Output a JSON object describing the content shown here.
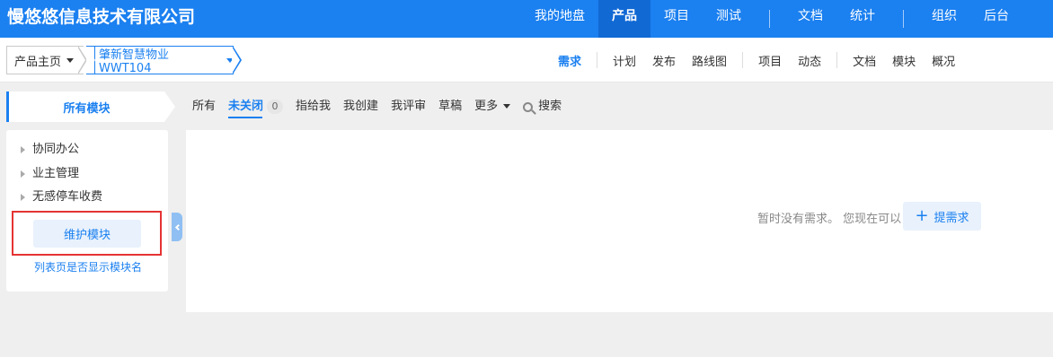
{
  "header": {
    "brand": "慢悠悠信息技术有限公司",
    "nav": [
      "我的地盘",
      "产品",
      "项目",
      "测试",
      "文档",
      "统计",
      "组织",
      "后台"
    ],
    "active_nav": "产品"
  },
  "breadcrumb": {
    "home": "产品主页",
    "product": "肇新智慧物业WWT104"
  },
  "subnav": [
    "需求",
    "计划",
    "发布",
    "路线图",
    "项目",
    "动态",
    "文档",
    "模块",
    "概况"
  ],
  "subnav_active": "需求",
  "module_panel": {
    "title": "所有模块",
    "tree": [
      "协同办公",
      "业主管理",
      "无感停车收费"
    ],
    "maintain_button": "维护模块",
    "show_module_name_link": "列表页是否显示模块名"
  },
  "filter_tabs": {
    "all": "所有",
    "unclosed": "未关闭",
    "unclosed_count": "0",
    "assigned_to_me": "指给我",
    "created_by_me": "我创建",
    "reviewed_by_me": "我评审",
    "draft": "草稿",
    "more": "更多",
    "search": "搜索"
  },
  "content": {
    "empty_message": "暂时没有需求。 您现在可以",
    "add_button": "提需求"
  },
  "colors": {
    "primary": "#1b80f0",
    "header_bg": "#1b80f0",
    "active_nav_bg": "#1169d4",
    "highlight_box": "#e53333"
  }
}
